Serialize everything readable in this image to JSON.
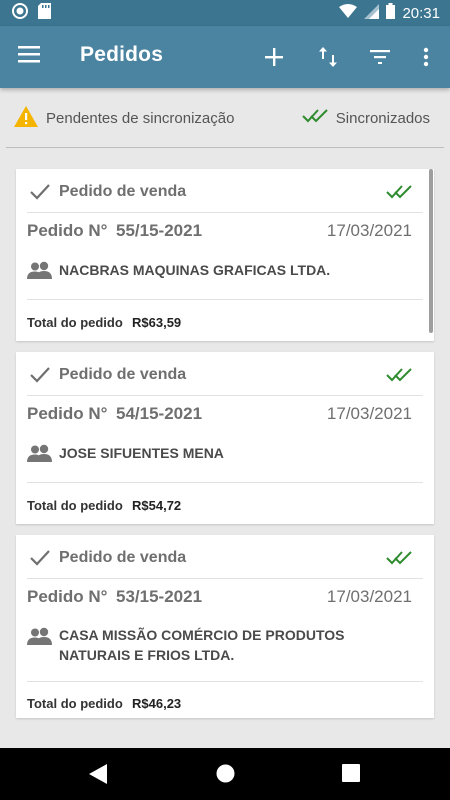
{
  "status_bar": {
    "time": "20:31",
    "icons": [
      "record-icon",
      "sd-card-icon",
      "wifi-icon",
      "signal-icon",
      "battery-icon"
    ]
  },
  "app_bar": {
    "title": "Pedidos",
    "actions": [
      "add-icon",
      "sort-icon",
      "filter-icon",
      "more-icon"
    ]
  },
  "filters": {
    "pending_label": "Pendentes de sincronização",
    "synced_label": "Sincronizados"
  },
  "orders": [
    {
      "type": "Pedido de venda",
      "number_label": "Pedido N°",
      "number": "55/15-2021",
      "date": "17/03/2021",
      "client": "NACBRAS MAQUINAS GRAFICAS LTDA.",
      "total_label": "Total do pedido",
      "total": "R$63,59"
    },
    {
      "type": "Pedido de venda",
      "number_label": "Pedido N°",
      "number": "54/15-2021",
      "date": "17/03/2021",
      "client": "JOSE SIFUENTES MENA",
      "total_label": "Total do pedido",
      "total": "R$54,72"
    },
    {
      "type": "Pedido de venda",
      "number_label": "Pedido N°",
      "number": "53/15-2021",
      "date": "17/03/2021",
      "client": "CASA MISSÃO COMÉRCIO DE PRODUTOS NATURAIS E FRIOS LTDA.",
      "total_label": "Total do pedido",
      "total": "R$46,23"
    }
  ],
  "colors": {
    "primary": "#4a84a1",
    "status_bar": "#3b7590",
    "synced_green": "#2e8b2e",
    "warning": "#f5b400"
  }
}
